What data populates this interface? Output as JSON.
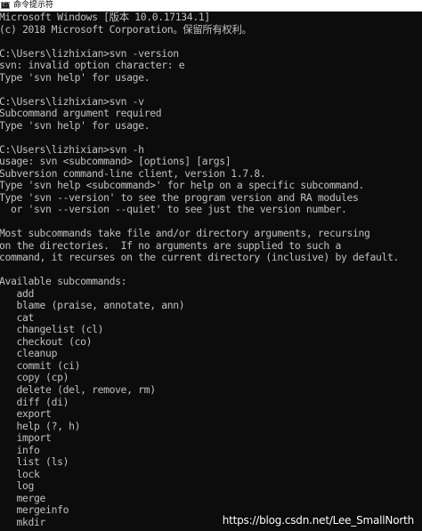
{
  "window": {
    "title": "命令提示符",
    "icon_name": "cmd-icon",
    "icon_glyph": "C:\\"
  },
  "console": {
    "lines": [
      "Microsoft Windows [版本 10.0.17134.1]",
      "(c) 2018 Microsoft Corporation。保留所有权利。",
      "",
      "C:\\Users\\lizhixian>svn -version",
      "svn: invalid option character: e",
      "Type 'svn help' for usage.",
      "",
      "C:\\Users\\lizhixian>svn -v",
      "Subcommand argument required",
      "Type 'svn help' for usage.",
      "",
      "C:\\Users\\lizhixian>svn -h",
      "usage: svn <subcommand> [options] [args]",
      "Subversion command-line client, version 1.7.8.",
      "Type 'svn help <subcommand>' for help on a specific subcommand.",
      "Type 'svn --version' to see the program version and RA modules",
      "  or 'svn --version --quiet' to see just the version number.",
      "",
      "Most subcommands take file and/or directory arguments, recursing",
      "on the directories.  If no arguments are supplied to such a",
      "command, it recurses on the current directory (inclusive) by default.",
      "",
      "Available subcommands:",
      "   add",
      "   blame (praise, annotate, ann)",
      "   cat",
      "   changelist (cl)",
      "   checkout (co)",
      "   cleanup",
      "   commit (ci)",
      "   copy (cp)",
      "   delete (del, remove, rm)",
      "   diff (di)",
      "   export",
      "   help (?, h)",
      "   import",
      "   info",
      "   list (ls)",
      "   lock",
      "   log",
      "   merge",
      "   mergeinfo",
      "   mkdir"
    ]
  },
  "watermark": "https://blog.csdn.net/Lee_SmallNorth",
  "colors": {
    "console_background": "#0c0c0c",
    "console_text": "#c0c0c0",
    "titlebar_background": "#ffffff"
  }
}
